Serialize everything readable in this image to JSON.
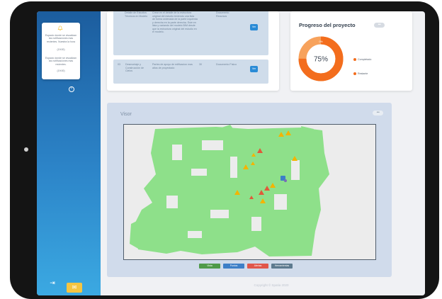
{
  "sidebar": {
    "notifications": [
      "Espacio donde se visualizan las notificaciones mas recientes. Nuestra la hora",
      "(19:00)",
      "Espacio donde se visualizan las notificaciones mas recientes.",
      "(19:00)"
    ],
    "icons": {
      "bell": "bell-icon",
      "back": "back-arrow-icon",
      "logout": "logout-icon",
      "help": "chat-help-icon"
    }
  },
  "tasks": {
    "rows": [
      {
        "num": "",
        "name": "Detalle de Estudios Técnicos en Modelo",
        "desc": "Crear en el detalle de la estructura original del estudio teniendo una lista de forma ordenada de la parte izquierda y derecha en la parte derecha. Este en lista y variando del modelo BIM desde que la estructura original del estudio en el modelo.",
        "code": "",
        "type": "Documento Recursos",
        "button": "Ver"
      },
      {
        "num": "03",
        "name": "Desmontaje y Construcción de Cielos",
        "desc": "Partes de apoyo de edificacion mas altos de proyectado",
        "code": "30",
        "type": "Documento Físico",
        "button": "Ver"
      }
    ]
  },
  "progress": {
    "title": "Progreso del proyecto",
    "value": "75%",
    "fraction": 0.75,
    "marker": "0%",
    "legend": [
      "Completado",
      "Restante"
    ],
    "colors": {
      "completed": "#f36d1d",
      "remaining": "#f7a25c"
    }
  },
  "visor": {
    "title": "Visor",
    "buttons": [
      {
        "label": "Vista",
        "color": "#4f9a4a"
      },
      {
        "label": "Puntos",
        "color": "#3d7fc7"
      },
      {
        "label": "Alertas",
        "color": "#e0574a"
      },
      {
        "label": "Herramientas",
        "color": "#5d7a8f"
      }
    ]
  },
  "footer": {
    "text": "Copyright © Spatia 2020"
  },
  "colors": {
    "accent": "#2a8bd6",
    "cloud": "#8ee08a",
    "warning": "#f4b400"
  }
}
